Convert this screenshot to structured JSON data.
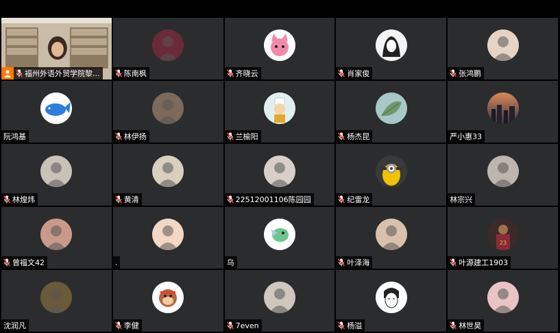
{
  "meeting": {
    "participants": [
      {
        "name": "福州外语外贸学院黎...",
        "avatar": "video-feed",
        "muted": true,
        "host": true,
        "color": "#a89a86"
      },
      {
        "name": "陈南枫",
        "avatar": "red-figure-avatar",
        "muted": true,
        "color": "#6a2a3a"
      },
      {
        "name": "齐晓云",
        "avatar": "pink-cat-avatar",
        "muted": true,
        "color": "#ffffff"
      },
      {
        "name": "肖家俊",
        "avatar": "sketch-girl-avatar",
        "muted": true,
        "color": "#f4f4f4"
      },
      {
        "name": "张鸿鹏",
        "avatar": "baby-avatar",
        "muted": true,
        "color": "#e7d3c4"
      },
      {
        "name": "阮鸿基",
        "avatar": "blue-whale-avatar",
        "muted": false,
        "color": "#ffffff"
      },
      {
        "name": "林伊扬",
        "avatar": "street-photo-avatar",
        "muted": true,
        "color": "#7d6a5a"
      },
      {
        "name": "兰榆阳",
        "avatar": "cartoon-boy-avatar",
        "muted": true,
        "color": "#dff0f0"
      },
      {
        "name": "杨杰昆",
        "avatar": "leaf-avatar",
        "muted": true,
        "color": "#a7c7c8"
      },
      {
        "name": "严小惠33",
        "avatar": "city-sunset-avatar",
        "muted": false,
        "color": "#3a3a40"
      },
      {
        "name": "林煌炜",
        "avatar": "person-shadow-avatar",
        "muted": true,
        "color": "#c9c2b6"
      },
      {
        "name": "黄清",
        "avatar": "plant-avatar",
        "muted": true,
        "color": "#d8cfbf"
      },
      {
        "name": "22512001106陈园园",
        "avatar": "girl-avatar",
        "muted": true,
        "color": "#d8d0c8"
      },
      {
        "name": "纪雷龙",
        "avatar": "minion-avatar",
        "muted": true,
        "color": "#f2c200"
      },
      {
        "name": "林宗兴",
        "avatar": "man-selfie-avatar",
        "muted": false,
        "color": "#bdb6ae"
      },
      {
        "name": "曾福文42",
        "avatar": "couple-sunset-avatar",
        "muted": true,
        "color": "#c99a8a"
      },
      {
        "name": ".",
        "avatar": "toddler-avatar",
        "muted": false,
        "color": "#f2d7c4"
      },
      {
        "name": "乌",
        "avatar": "cartoon-bird-avatar",
        "muted": false,
        "color": "#ffffff"
      },
      {
        "name": "叶泽海",
        "avatar": "child-face-avatar",
        "muted": true,
        "color": "#d8c0aa"
      },
      {
        "name": "叶源建工1903",
        "avatar": "basketball-player-avatar",
        "muted": true,
        "color": "#8a2a3a"
      },
      {
        "name": "沈润凡",
        "avatar": "dark-portrait-avatar",
        "muted": false,
        "color": "#6a5a3a"
      },
      {
        "name": "李健",
        "avatar": "monkey-avatar",
        "muted": true,
        "color": "#ffffff"
      },
      {
        "name": "7even",
        "avatar": "figure-avatar",
        "muted": true,
        "color": "#cfc7bc"
      },
      {
        "name": "杨溢",
        "avatar": "anime-boy-avatar",
        "muted": true,
        "color": "#ffffff"
      },
      {
        "name": "林世昊",
        "avatar": "hand-avatar",
        "muted": true,
        "color": "#e8c4c4"
      }
    ]
  }
}
